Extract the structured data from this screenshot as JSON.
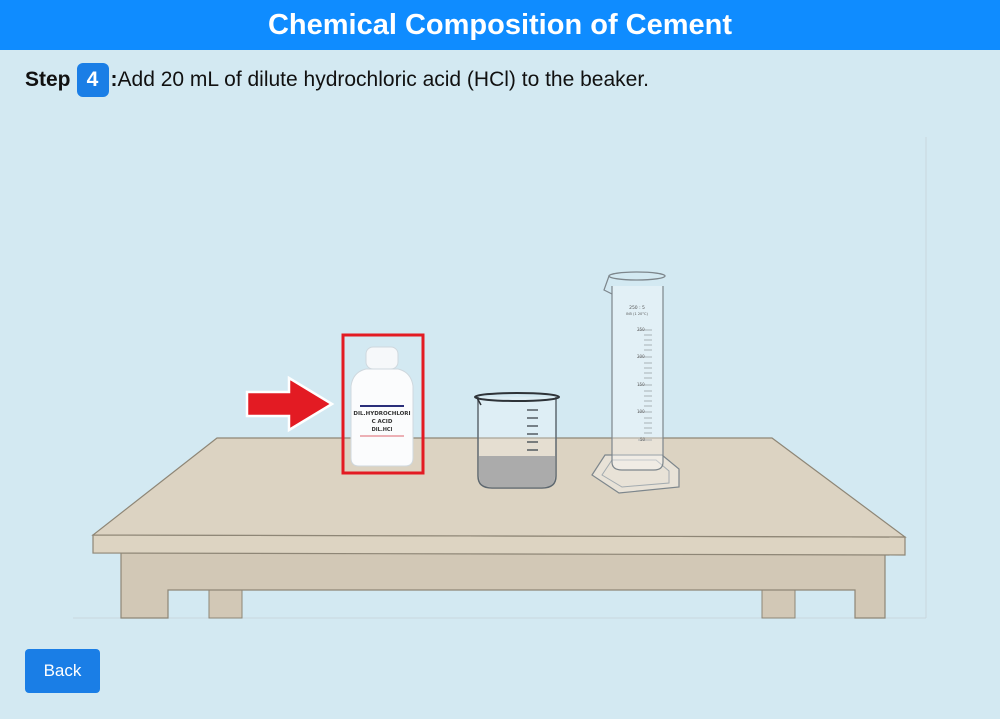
{
  "header": {
    "title": "Chemical Composition of Cement"
  },
  "step": {
    "label": "Step",
    "number": "4",
    "colon": ":",
    "instruction": "Add 20 mL of dilute hydrochloric acid (HCl) to the beaker."
  },
  "scene": {
    "bottle_label_lines": [
      "DIL.HYDROCHLORI",
      "C ACID",
      "DIL.HCl"
    ],
    "cylinder_header_lines": [
      "250 : 5",
      "IN5 (1 20°C)"
    ],
    "cylinder_ticks": [
      "250",
      "200",
      "150",
      "100",
      "50"
    ],
    "highlight_color": "#e31b23",
    "arrow_color": "#e31b23"
  },
  "nav": {
    "back_label": "Back"
  }
}
